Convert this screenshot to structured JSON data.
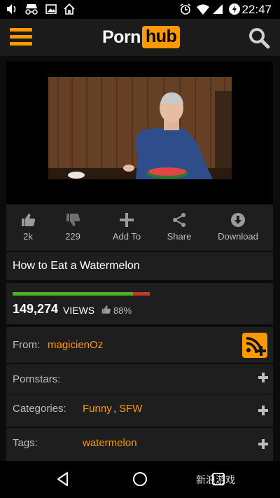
{
  "status_bar": {
    "time": "22:47",
    "icons": [
      "volume-icon",
      "incognito-icon",
      "image-icon",
      "home-icon",
      "alarm-icon",
      "wifi-icon",
      "signal-icon",
      "battery-icon"
    ]
  },
  "header": {
    "logo_left": "Porn",
    "logo_right": "hub",
    "accent_color": "#ff9900"
  },
  "actions": [
    {
      "icon": "thumbs-up-icon",
      "label": "2k"
    },
    {
      "icon": "thumbs-down-icon",
      "label": "229"
    },
    {
      "icon": "plus-icon",
      "label": "Add To"
    },
    {
      "icon": "share-icon",
      "label": "Share"
    },
    {
      "icon": "download-icon",
      "label": "Download"
    }
  ],
  "video": {
    "title": "How to Eat a Watermelon",
    "views": "149,274",
    "views_label": "VIEWS",
    "rating": "88%",
    "rating_fraction": 0.88
  },
  "details": {
    "from_label": "From:",
    "from_value": "magicienOz",
    "pornstars_label": "Pornstars:",
    "categories_label": "Categories:",
    "categories": [
      "Funny",
      "SFW"
    ],
    "category_separator": ",",
    "tags_label": "Tags:",
    "tags": [
      "watermelon"
    ]
  },
  "navbar": {
    "buttons": [
      "back-icon",
      "home-icon",
      "recents-icon"
    ]
  },
  "watermark": {
    "text": "新浪游戏"
  }
}
